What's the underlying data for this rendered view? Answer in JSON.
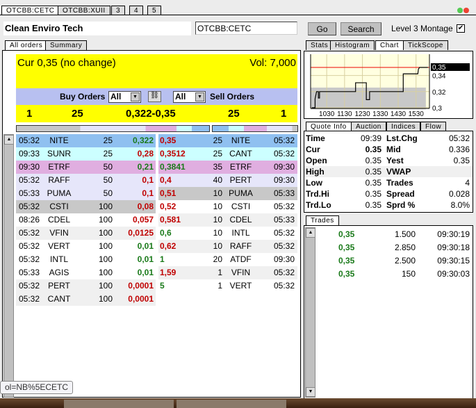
{
  "window_tabs": [
    "OTCBB:CETC",
    "OTCBB:XUII",
    "3",
    "4",
    "5"
  ],
  "header": {
    "company": "Clean Enviro Tech",
    "symbol_value": "OTCBB:CETC",
    "go_label": "Go",
    "search_label": "Search",
    "level3_label": "Level 3 Montage",
    "level3_checked": true
  },
  "left_tabs": [
    "All orders",
    "Summary"
  ],
  "summary": {
    "cur": "Cur 0,35 (no change)",
    "vol": "Vol: 7,000",
    "buy_label": "Buy Orders",
    "sell_label": "Sell Orders",
    "buy_filter": "All",
    "sell_filter": "All",
    "buy_count": "1",
    "buy_size": "25",
    "spread": "0,322-0,35",
    "sell_size": "25",
    "sell_count": "1"
  },
  "colors": {
    "blue": "#8fc0f0",
    "cyan": "#ccffff",
    "pink": "#e0aee0",
    "lavender": "#e6e6fa",
    "gray": "#c8c8c8",
    "light": "#f0f0f0",
    "white": "#ffffff",
    "yellow": "#ffff00",
    "filter_bar": "#b8c0f0",
    "green": "#1a7a1a",
    "red": "#c00000"
  },
  "buy_orders": [
    {
      "time": "05:32",
      "mm": "NITE",
      "size": "25",
      "price": "0,322",
      "dir": "g",
      "bg": "blue"
    },
    {
      "time": "09:33",
      "mm": "SUNR",
      "size": "25",
      "price": "0,28",
      "dir": "r",
      "bg": "cyan"
    },
    {
      "time": "09:30",
      "mm": "ETRF",
      "size": "50",
      "price": "0,21",
      "dir": "g",
      "bg": "pink"
    },
    {
      "time": "05:32",
      "mm": "RAFF",
      "size": "50",
      "price": "0,1",
      "dir": "r",
      "bg": "lavender"
    },
    {
      "time": "05:33",
      "mm": "PUMA",
      "size": "50",
      "price": "0,1",
      "dir": "r",
      "bg": "lavender"
    },
    {
      "time": "05:32",
      "mm": "CSTI",
      "size": "100",
      "price": "0,08",
      "dir": "r",
      "bg": "gray"
    },
    {
      "time": "08:26",
      "mm": "CDEL",
      "size": "100",
      "price": "0,057",
      "dir": "r",
      "bg": "white"
    },
    {
      "time": "05:32",
      "mm": "VFIN",
      "size": "100",
      "price": "0,0125",
      "dir": "r",
      "bg": "light"
    },
    {
      "time": "05:32",
      "mm": "VERT",
      "size": "100",
      "price": "0,01",
      "dir": "g",
      "bg": "white"
    },
    {
      "time": "05:32",
      "mm": "INTL",
      "size": "100",
      "price": "0,01",
      "dir": "g",
      "bg": "white"
    },
    {
      "time": "05:33",
      "mm": "AGIS",
      "size": "100",
      "price": "0,01",
      "dir": "g",
      "bg": "white"
    },
    {
      "time": "05:32",
      "mm": "PERT",
      "size": "100",
      "price": "0,0001",
      "dir": "r",
      "bg": "light"
    },
    {
      "time": "05:32",
      "mm": "CANT",
      "size": "100",
      "price": "0,0001",
      "dir": "r",
      "bg": "light"
    }
  ],
  "sell_orders": [
    {
      "price": "0,35",
      "dir": "r",
      "size": "25",
      "mm": "NITE",
      "time": "05:32",
      "bg": "blue"
    },
    {
      "price": "0,3512",
      "dir": "r",
      "size": "25",
      "mm": "CANT",
      "time": "05:32",
      "bg": "cyan"
    },
    {
      "price": "0,3841",
      "dir": "g",
      "size": "35",
      "mm": "ETRF",
      "time": "09:30",
      "bg": "pink"
    },
    {
      "price": "0,4",
      "dir": "r",
      "size": "40",
      "mm": "PERT",
      "time": "09:30",
      "bg": "lavender"
    },
    {
      "price": "0,51",
      "dir": "r",
      "size": "10",
      "mm": "PUMA",
      "time": "05:33",
      "bg": "gray"
    },
    {
      "price": "0,52",
      "dir": "r",
      "size": "10",
      "mm": "CSTI",
      "time": "05:32",
      "bg": "white"
    },
    {
      "price": "0,581",
      "dir": "r",
      "size": "10",
      "mm": "CDEL",
      "time": "05:33",
      "bg": "light"
    },
    {
      "price": "0,6",
      "dir": "g",
      "size": "10",
      "mm": "INTL",
      "time": "05:32",
      "bg": "white"
    },
    {
      "price": "0,62",
      "dir": "r",
      "size": "10",
      "mm": "RAFF",
      "time": "05:32",
      "bg": "light"
    },
    {
      "price": "1",
      "dir": "g",
      "size": "20",
      "mm": "ATDF",
      "time": "09:30",
      "bg": "white"
    },
    {
      "price": "1,59",
      "dir": "r",
      "size": "1",
      "mm": "VFIN",
      "time": "05:32",
      "bg": "light"
    },
    {
      "price": "5",
      "dir": "g",
      "size": "1",
      "mm": "VERT",
      "time": "05:32",
      "bg": "white"
    }
  ],
  "right_tabs": [
    "Stats",
    "Histogram",
    "Chart",
    "TickScope"
  ],
  "chart_data": {
    "type": "line",
    "x_ticks": [
      "1030",
      "1130",
      "1230",
      "1330",
      "1430",
      "1530"
    ],
    "y_ticks": [
      "0,35",
      "0,34",
      "0,32",
      "0,3"
    ],
    "current_label": "0,35",
    "ylim": [
      0.29,
      0.355
    ],
    "grid": true,
    "points": [
      [
        "09:40",
        0.3
      ],
      [
        "09:51",
        0.3
      ],
      [
        "09:51",
        0.311
      ],
      [
        "09:56",
        0.32
      ],
      [
        "10:02",
        0.32
      ],
      [
        "10:02",
        0.312
      ],
      [
        "10:06",
        0.312
      ],
      [
        "10:06",
        0.32
      ],
      [
        "12:07",
        0.32
      ],
      [
        "12:07",
        0.331
      ],
      [
        "12:43",
        0.331
      ],
      [
        "12:43",
        0.31
      ],
      [
        "12:54",
        0.31
      ],
      [
        "12:54",
        0.32
      ],
      [
        "14:47",
        0.32
      ],
      [
        "14:47",
        0.342
      ],
      [
        "15:36",
        0.342
      ],
      [
        "15:38",
        0.348
      ],
      [
        "15:42",
        0.35
      ],
      [
        "16:10",
        0.35
      ]
    ]
  },
  "quote_tabs": [
    "Quote Info",
    "Auction",
    "Indices",
    "Flow"
  ],
  "quote": [
    [
      "Time",
      "09:39",
      "Lst.Chg",
      "05:32"
    ],
    [
      "Cur",
      "0.35",
      "Mid",
      "0.336"
    ],
    [
      "Open",
      "0.35",
      "Yest",
      "0.35"
    ],
    [
      "High",
      "0.35",
      "VWAP",
      ""
    ],
    [
      "Low",
      "0.35",
      "Trades",
      "4"
    ],
    [
      "Trd.Hi",
      "0.35",
      "Spread",
      "0.028"
    ],
    [
      "Trd.Lo",
      "0.35",
      "Sprd %",
      "8.0%"
    ]
  ],
  "trades_tab": "Trades",
  "trades": [
    [
      "0,35",
      "1.500",
      "09:30:19"
    ],
    [
      "0,35",
      "2.850",
      "09:30:18"
    ],
    [
      "0,35",
      "2.500",
      "09:30:15"
    ],
    [
      "0,35",
      "150",
      "09:30:03"
    ]
  ],
  "tooltip": "ol=NB%5ECETC"
}
